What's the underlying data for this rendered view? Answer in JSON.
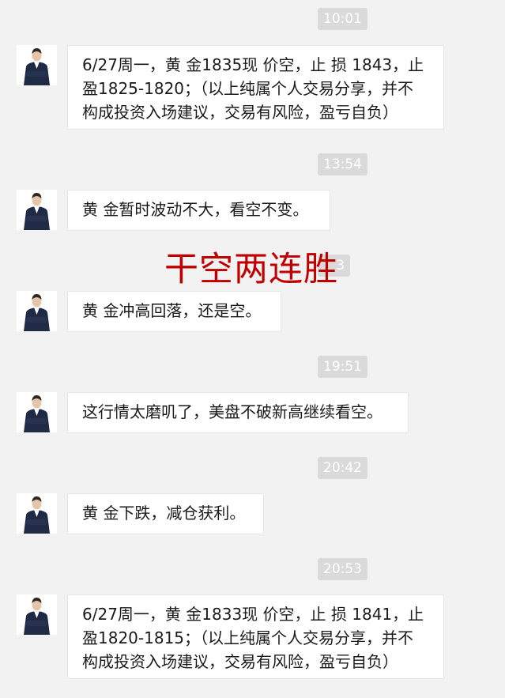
{
  "messages": [
    {
      "time": "10:01",
      "text": "6/27周一，黄 金1835现 价空，止 损 1843，止\n盈1825-1820；（以上纯属个人交易分享，并不\n构成投资入场建议，交易有风险，盈亏自负）"
    },
    {
      "time": "13:54",
      "text": "黄 金暂时波动不大，看空不变。"
    },
    {
      "time": "",
      "text": "黄 金冲高回落，还是空。"
    },
    {
      "time": "19:51",
      "text": "这行情太磨叽了，美盘不破新高继续看空。"
    },
    {
      "time": "20:42",
      "text": "黄 金下跌，减仓获利。"
    },
    {
      "time": "20:53",
      "text": "6/27周一，黄 金1833现 价空，止 损 1841，止\n盈1820-1815；（以上纯属个人交易分享，并不\n构成投资入场建议，交易有风险，盈亏自负）"
    }
  ],
  "overlay": {
    "watermark": "干空两连胜",
    "watermark_color": "#c00000"
  },
  "icons": {
    "avatar": "avatar-icon"
  },
  "colors": {
    "background": "#f2f2f2",
    "bubble": "#ffffff",
    "time_pill": "#dadada",
    "text": "#1a1a1a"
  }
}
